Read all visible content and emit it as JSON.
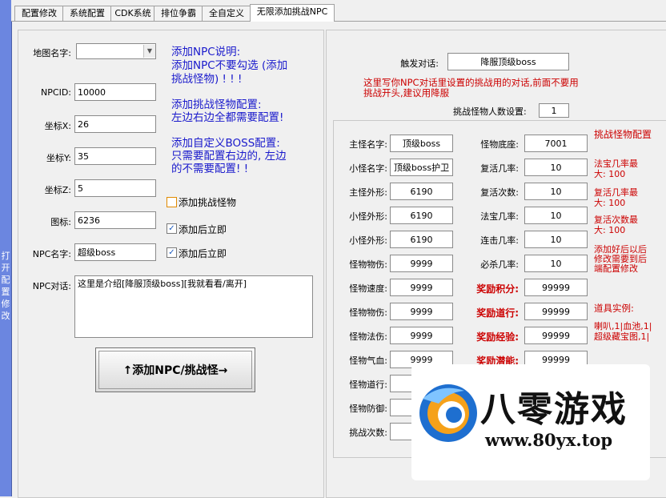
{
  "sidebar": {
    "label": "打开配置修改"
  },
  "tabs": [
    "配置修改",
    "系统配置",
    "CDK系统",
    "排位争霸",
    "全自定义",
    "无限添加挑战NPC"
  ],
  "left": {
    "map_label": "地图名字:",
    "map_value": "",
    "npcid_label": "NPCID:",
    "npcid_value": "10000",
    "x_label": "坐标X:",
    "x_value": "26",
    "y_label": "坐标Y:",
    "y_value": "35",
    "z_label": "坐标Z:",
    "z_value": "5",
    "icon_label": "图标:",
    "icon_value": "6236",
    "npcname_label": "NPC名字:",
    "npcname_value": "超级boss",
    "dialog_label": "NPC对话:",
    "dialog_value": "这里是介绍[降服顶级boss][我就看看/离开]",
    "info_lines": [
      "添加NPC说明:",
      "添加NPC不要勾选 (添加",
      "挑战怪物) ! ! !",
      "添加挑战怪物配置:",
      "左边右边全都需要配置!",
      "添加自定义BOSS配置:",
      "只需要配置右边的, 左边",
      "的不需要配置! !"
    ],
    "check1_label": "添加挑战怪物",
    "check2_label": "添加后立即",
    "check3_label": "添加后立即",
    "add_button": "↑添加NPC/挑战怪→"
  },
  "right": {
    "trigger_label": "触发对话:",
    "trigger_value": "降服顶级boss",
    "trigger_note": "这里写你NPC对话里设置的挑战用的对话,前面不要用挑战开头,建议用降服",
    "count_label": "挑战怪物人数设置:",
    "count_value": "1",
    "left_rows": [
      {
        "label": "主怪名字:",
        "value": "顶级boss"
      },
      {
        "label": "小怪名字:",
        "value": "顶级boss护卫"
      },
      {
        "label": "主怪外形:",
        "value": "6190"
      },
      {
        "label": "小怪外形:",
        "value": "6190"
      },
      {
        "label": "小怪外形:",
        "value": "6190"
      },
      {
        "label": "怪物物伤:",
        "value": "9999"
      },
      {
        "label": "怪物速度:",
        "value": "9999"
      },
      {
        "label": "怪物物伤:",
        "value": "9999"
      },
      {
        "label": "怪物法伤:",
        "value": "9999"
      },
      {
        "label": "怪物气血:",
        "value": "9999"
      },
      {
        "label": "怪物道行:",
        "value": ""
      },
      {
        "label": "怪物防御:",
        "value": ""
      },
      {
        "label": "挑战次数:",
        "value": ""
      }
    ],
    "mid_rows": [
      {
        "label": "怪物底座:",
        "value": "7001",
        "red": false
      },
      {
        "label": "复活几率:",
        "value": "10",
        "red": false
      },
      {
        "label": "复活次数:",
        "value": "10",
        "red": false
      },
      {
        "label": "法宝几率:",
        "value": "10",
        "red": false
      },
      {
        "label": "连击几率:",
        "value": "10",
        "red": false
      },
      {
        "label": "必杀几率:",
        "value": "10",
        "red": false
      },
      {
        "label": "奖励积分:",
        "value": "99999",
        "red": true
      },
      {
        "label": "奖励道行:",
        "value": "99999",
        "red": true
      },
      {
        "label": "奖励经验:",
        "value": "99999",
        "red": true
      },
      {
        "label": "奖励潜能:",
        "value": "99999",
        "red": true
      }
    ],
    "notes": {
      "n1": "挑战怪物配置",
      "n2": "法宝几率最大: 100",
      "n3": "复活几率最大: 100",
      "n4": "复活次数最大: 100",
      "n5": "添加好后以后修改需要到后端配置修改",
      "n6": "道具实例:",
      "n7": "喇叭,1|血池,1|超级藏宝图,1|"
    }
  },
  "watermark": {
    "brand": "八零游戏",
    "url": "www.80yx.top"
  }
}
